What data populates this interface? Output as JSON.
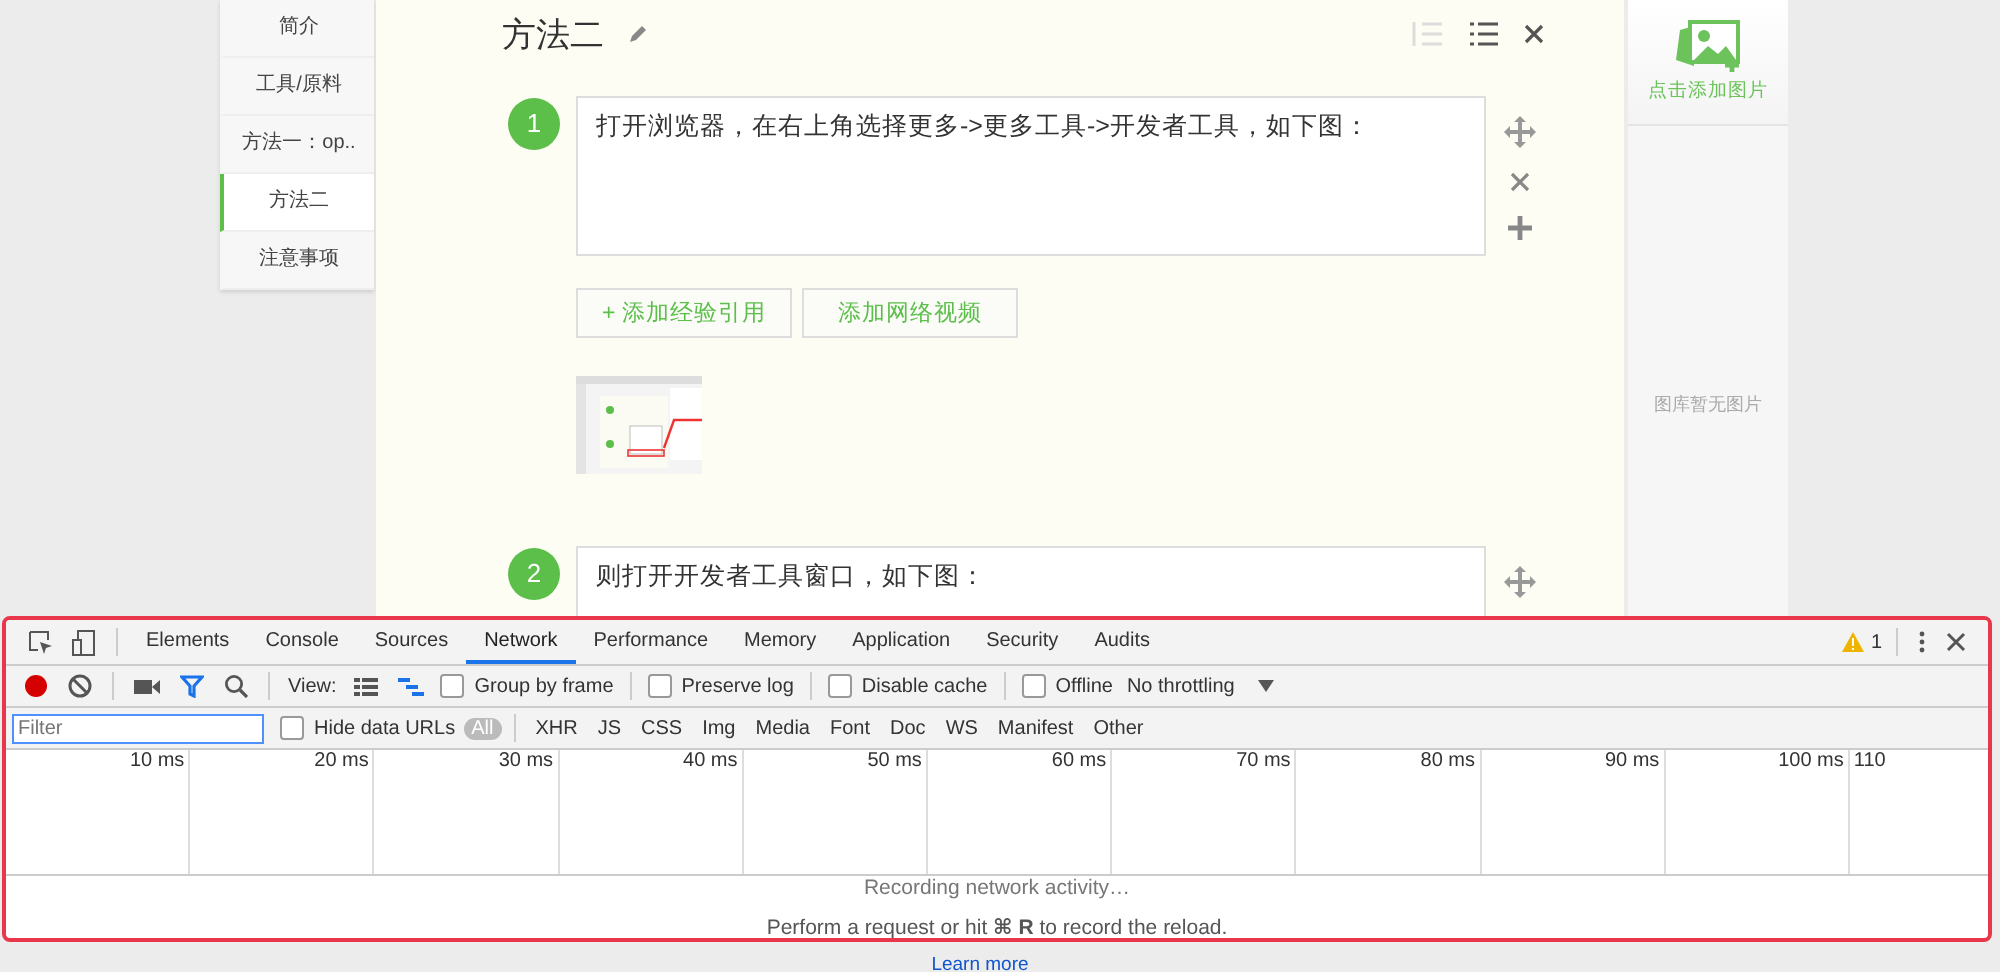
{
  "sidebar": {
    "items": [
      {
        "label": "简介",
        "selected": false
      },
      {
        "label": "工具/原料",
        "selected": false
      },
      {
        "label": "方法一：op..",
        "selected": false
      },
      {
        "label": "方法二",
        "selected": true
      },
      {
        "label": "注意事项",
        "selected": false
      }
    ]
  },
  "editor": {
    "title": "方法二",
    "steps": [
      {
        "number": "1",
        "text": "打开浏览器，在右上角选择更多->更多工具->开发者工具，如下图：",
        "buttons": [
          "+ 添加经验引用",
          "添加网络视频"
        ]
      },
      {
        "number": "2",
        "text": "则打开开发者工具窗口，如下图："
      }
    ]
  },
  "image_panel": {
    "add_label": "点击添加图片",
    "empty_text": "图库暂无图片"
  },
  "devtools": {
    "tabs": [
      {
        "label": "Elements",
        "selected": false
      },
      {
        "label": "Console",
        "selected": false
      },
      {
        "label": "Sources",
        "selected": false
      },
      {
        "label": "Network",
        "selected": true
      },
      {
        "label": "Performance",
        "selected": false
      },
      {
        "label": "Memory",
        "selected": false
      },
      {
        "label": "Application",
        "selected": false
      },
      {
        "label": "Security",
        "selected": false
      },
      {
        "label": "Audits",
        "selected": false
      }
    ],
    "warning_count": "1",
    "recording": true,
    "view_label": "View:",
    "options": [
      {
        "label": "Group by frame",
        "checked": false
      },
      {
        "label": "Preserve log",
        "checked": false
      },
      {
        "label": "Disable cache",
        "checked": false
      },
      {
        "label": "Offline",
        "checked": false
      }
    ],
    "throttling": "No throttling",
    "filter": {
      "placeholder": "Filter"
    },
    "hide_data_urls": {
      "label": "Hide data URLs",
      "checked": false
    },
    "types": [
      {
        "label": "All",
        "selected": true
      },
      {
        "label": "XHR",
        "selected": false
      },
      {
        "label": "JS",
        "selected": false
      },
      {
        "label": "CSS",
        "selected": false
      },
      {
        "label": "Img",
        "selected": false
      },
      {
        "label": "Media",
        "selected": false
      },
      {
        "label": "Font",
        "selected": false
      },
      {
        "label": "Doc",
        "selected": false
      },
      {
        "label": "WS",
        "selected": false
      },
      {
        "label": "Manifest",
        "selected": false
      },
      {
        "label": "Other",
        "selected": false
      }
    ],
    "timeline_ticks": [
      "10 ms",
      "20 ms",
      "30 ms",
      "40 ms",
      "50 ms",
      "60 ms",
      "70 ms",
      "80 ms",
      "90 ms",
      "100 ms",
      "110"
    ],
    "messages": [
      "Recording network activity…",
      "Perform a request or hit **⌘ R** to record the reload."
    ],
    "link": "Learn more"
  }
}
